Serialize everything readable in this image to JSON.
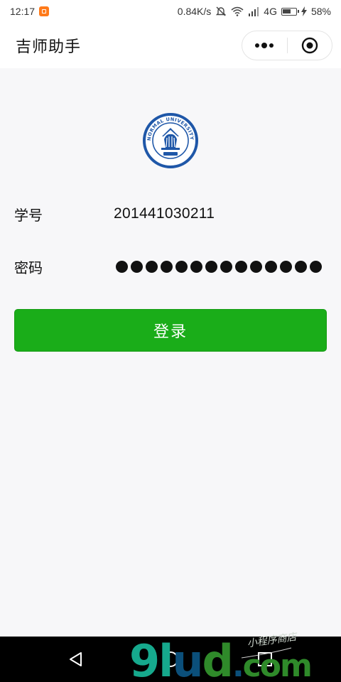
{
  "status_bar": {
    "time": "12:17",
    "network_speed": "0.84K/s",
    "network_type": "4G",
    "battery": "58%",
    "icons": [
      "app-notification-icon",
      "mute-icon",
      "wifi-icon",
      "signal-icon",
      "battery-icon",
      "charging-icon"
    ]
  },
  "nav": {
    "title": "吉师助手",
    "menu_icon": "more-dots-icon",
    "close_icon": "target-circle-icon"
  },
  "logo": {
    "icon": "university-seal-icon",
    "text": "JILIN NORMAL UNIVERSITY 1958"
  },
  "form": {
    "student_id_label": "学号",
    "student_id_value": "201441030211",
    "password_label": "密码",
    "password_mask_count": 14
  },
  "login_button": {
    "label": "登录"
  },
  "system_nav": {
    "icons": [
      "back-triangle-icon",
      "home-circle-icon",
      "recent-square-icon"
    ]
  },
  "watermark": {
    "text": "9lud.com",
    "script_text": "小程序商店"
  },
  "colors": {
    "primary": "#1aad19",
    "background": "#f7f7f9",
    "seal_blue": "#1f57a8",
    "watermark_teal": "#16a98d",
    "watermark_dark": "#0b4f7a",
    "watermark_green": "#2f8a2a"
  }
}
